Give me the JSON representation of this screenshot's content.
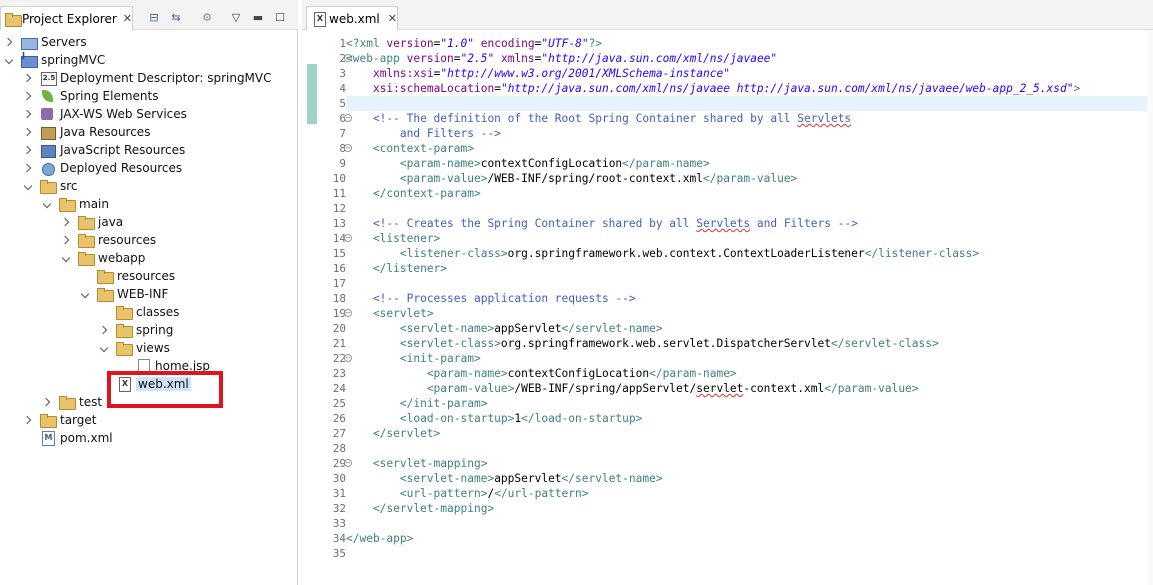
{
  "explorer": {
    "title": "Project Explorer",
    "close_glyph": "✕",
    "tree": [
      {
        "label": "Servers",
        "depth": 0,
        "twisty": "closed",
        "icon": "servers-icon"
      },
      {
        "label": "springMVC",
        "depth": 0,
        "twisty": "open",
        "icon": "project-icon"
      },
      {
        "label": "Deployment Descriptor: springMVC",
        "depth": 1,
        "twisty": "closed",
        "icon": "deployment-descriptor-icon"
      },
      {
        "label": "Spring Elements",
        "depth": 1,
        "twisty": "closed",
        "icon": "spring-icon"
      },
      {
        "label": "JAX-WS Web Services",
        "depth": 1,
        "twisty": "closed",
        "icon": "webservices-icon"
      },
      {
        "label": "Java Resources",
        "depth": 1,
        "twisty": "closed",
        "icon": "java-resources-icon"
      },
      {
        "label": "JavaScript Resources",
        "depth": 1,
        "twisty": "closed",
        "icon": "javascript-resources-icon"
      },
      {
        "label": "Deployed Resources",
        "depth": 1,
        "twisty": "closed",
        "icon": "deployed-resources-icon"
      },
      {
        "label": "src",
        "depth": 1,
        "twisty": "open",
        "icon": "folder-icon"
      },
      {
        "label": "main",
        "depth": 2,
        "twisty": "open",
        "icon": "folder-icon"
      },
      {
        "label": "java",
        "depth": 3,
        "twisty": "closed",
        "icon": "folder-icon"
      },
      {
        "label": "resources",
        "depth": 3,
        "twisty": "closed",
        "icon": "folder-icon"
      },
      {
        "label": "webapp",
        "depth": 3,
        "twisty": "open",
        "icon": "folder-icon"
      },
      {
        "label": "resources",
        "depth": 4,
        "twisty": "none",
        "icon": "folder-icon"
      },
      {
        "label": "WEB-INF",
        "depth": 4,
        "twisty": "open",
        "icon": "folder-icon"
      },
      {
        "label": "classes",
        "depth": 5,
        "twisty": "none",
        "icon": "folder-icon"
      },
      {
        "label": "spring",
        "depth": 5,
        "twisty": "closed",
        "icon": "folder-icon"
      },
      {
        "label": "views",
        "depth": 5,
        "twisty": "open",
        "icon": "folder-icon"
      },
      {
        "label": "home.jsp",
        "depth": 6,
        "twisty": "none",
        "icon": "file-icon"
      },
      {
        "label": "web.xml",
        "depth": 5,
        "twisty": "none",
        "icon": "xml-file-icon",
        "selected": true
      },
      {
        "label": "test",
        "depth": 2,
        "twisty": "closed",
        "icon": "folder-icon"
      },
      {
        "label": "target",
        "depth": 1,
        "twisty": "closed",
        "icon": "folder-icon"
      },
      {
        "label": "pom.xml",
        "depth": 1,
        "twisty": "none",
        "icon": "pom-file-icon"
      }
    ]
  },
  "editor": {
    "tab_label": "web.xml",
    "close_glyph": "✕",
    "current_line": 5,
    "fold_lines": [
      2,
      6,
      8,
      14,
      19,
      22,
      29
    ],
    "lines": [
      [
        [
          "pi",
          "<?xml "
        ],
        [
          "attr",
          "version"
        ],
        [
          "txt",
          "="
        ],
        [
          "str",
          "\"1.0\""
        ],
        [
          "txt",
          " "
        ],
        [
          "attr",
          "encoding"
        ],
        [
          "txt",
          "="
        ],
        [
          "str",
          "\"UTF-8\""
        ],
        [
          "pi",
          "?>"
        ]
      ],
      [
        [
          "tag",
          "<web-app "
        ],
        [
          "attr",
          "version"
        ],
        [
          "txt",
          "="
        ],
        [
          "str",
          "\"2.5\""
        ],
        [
          "txt",
          " "
        ],
        [
          "attr",
          "xmlns"
        ],
        [
          "txt",
          "="
        ],
        [
          "str",
          "\"http://java.sun.com/xml/ns/javaee\""
        ]
      ],
      [
        [
          "txt",
          "    "
        ],
        [
          "attr",
          "xmlns:xsi"
        ],
        [
          "txt",
          "="
        ],
        [
          "str",
          "\"http://www.w3.org/2001/XMLSchema-instance\""
        ]
      ],
      [
        [
          "txt",
          "    "
        ],
        [
          "attr",
          "xsi:schemaLocation"
        ],
        [
          "txt",
          "="
        ],
        [
          "str",
          "\"http://java.sun.com/xml/ns/javaee http://java.sun.com/xml/ns/javaee/web-app_2_5.xsd\""
        ],
        [
          "tag",
          ">"
        ]
      ],
      [],
      [
        [
          "comment",
          "    <!-- The definition of the Root Spring Container shared by all "
        ],
        [
          "comment squiggle",
          "Servlets"
        ]
      ],
      [
        [
          "comment",
          "        and Filters -->"
        ]
      ],
      [
        [
          "tag",
          "    <context-param>"
        ]
      ],
      [
        [
          "tag",
          "        <param-name>"
        ],
        [
          "txt",
          "contextConfigLocation"
        ],
        [
          "tag",
          "</param-name>"
        ]
      ],
      [
        [
          "tag",
          "        <param-value>"
        ],
        [
          "txt",
          "/WEB-INF/spring/root-context.xml"
        ],
        [
          "tag",
          "</param-value>"
        ]
      ],
      [
        [
          "tag",
          "    </context-param>"
        ]
      ],
      [],
      [
        [
          "comment",
          "    <!-- Creates the Spring Container shared by all "
        ],
        [
          "comment squiggle",
          "Servlets"
        ],
        [
          "comment",
          " and Filters -->"
        ]
      ],
      [
        [
          "tag",
          "    <listener>"
        ]
      ],
      [
        [
          "tag",
          "        <listener-class>"
        ],
        [
          "txt",
          "org.springframework.web.context.ContextLoaderListener"
        ],
        [
          "tag",
          "</listener-class>"
        ]
      ],
      [
        [
          "tag",
          "    </listener>"
        ]
      ],
      [],
      [
        [
          "comment",
          "    <!-- Processes application requests -->"
        ]
      ],
      [
        [
          "tag",
          "    <servlet>"
        ]
      ],
      [
        [
          "tag",
          "        <servlet-name>"
        ],
        [
          "txt",
          "appServlet"
        ],
        [
          "tag",
          "</servlet-name>"
        ]
      ],
      [
        [
          "tag",
          "        <servlet-class>"
        ],
        [
          "txt",
          "org.springframework.web.servlet.DispatcherServlet"
        ],
        [
          "tag",
          "</servlet-class>"
        ]
      ],
      [
        [
          "tag",
          "        <init-param>"
        ]
      ],
      [
        [
          "tag",
          "            <param-name>"
        ],
        [
          "txt",
          "contextConfigLocation"
        ],
        [
          "tag",
          "</param-name>"
        ]
      ],
      [
        [
          "tag",
          "            <param-value>"
        ],
        [
          "txt",
          "/WEB-INF/spring/appServlet/"
        ],
        [
          "txt squiggle",
          "servlet"
        ],
        [
          "txt",
          "-context.xml"
        ],
        [
          "tag",
          "</param-value>"
        ]
      ],
      [
        [
          "tag",
          "        </init-param>"
        ]
      ],
      [
        [
          "tag",
          "        <load-on-startup>"
        ],
        [
          "txt",
          "1"
        ],
        [
          "tag",
          "</load-on-startup>"
        ]
      ],
      [
        [
          "tag",
          "    </servlet>"
        ]
      ],
      [],
      [
        [
          "tag",
          "    <servlet-mapping>"
        ]
      ],
      [
        [
          "tag",
          "        <servlet-name>"
        ],
        [
          "txt",
          "appServlet"
        ],
        [
          "tag",
          "</servlet-name>"
        ]
      ],
      [
        [
          "tag",
          "        <url-pattern>"
        ],
        [
          "txt",
          "/"
        ],
        [
          "tag",
          "</url-pattern>"
        ]
      ],
      [
        [
          "tag",
          "    </servlet-mapping>"
        ]
      ],
      [],
      [
        [
          "tag",
          "</web-app>"
        ]
      ],
      []
    ]
  },
  "colors": {
    "highlight_box": "#e0141b",
    "selection": "#cfe3fb",
    "current_line": "#e8f2fe",
    "tag": "#3f7f7f",
    "attribute": "#7f007f",
    "string": "#2a00ff",
    "comment": "#3f5fbf"
  }
}
